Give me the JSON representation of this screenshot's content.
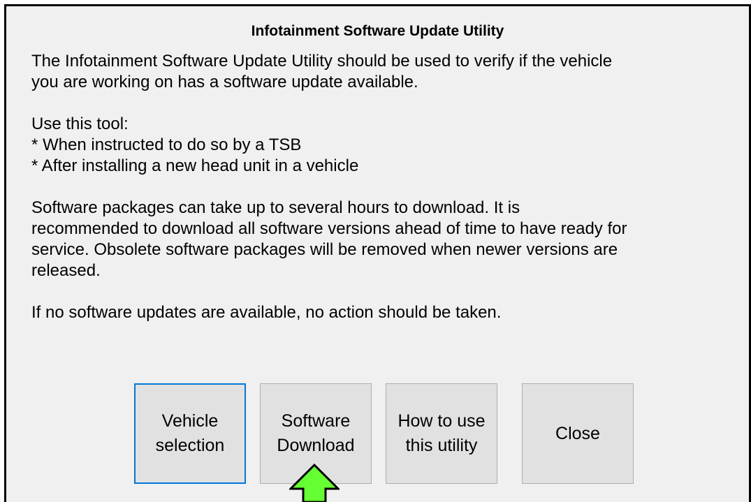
{
  "dialog": {
    "title": "Infotainment Software Update Utility",
    "lines": [
      "The Infotainment Software Update Utility should be used to verify if the vehicle",
      "you are working on has a software update available.",
      "Use this tool:",
      "* When instructed to do so by a TSB",
      "* After installing a new head unit in a vehicle",
      "Software packages can take up to several hours to download.  It is",
      "recommended to download all software versions ahead of time to have ready for",
      "service.  Obsolete software packages will be removed when newer versions are",
      "released.",
      "If no software updates are available, no action should be taken."
    ]
  },
  "buttons": {
    "vehicle_selection": [
      "Vehicle",
      "selection"
    ],
    "software_download": [
      "Software",
      "Download"
    ],
    "how_to_use": [
      "How to use",
      "this utility"
    ],
    "close": "Close"
  },
  "colors": {
    "dialog_bg": "#f0f0f0",
    "button_bg": "#e1e1e1",
    "focus_border": "#0078d7",
    "arrow_fill": "#66ff33"
  },
  "icons": {
    "pointer_arrow": "green-up-arrow-icon"
  }
}
